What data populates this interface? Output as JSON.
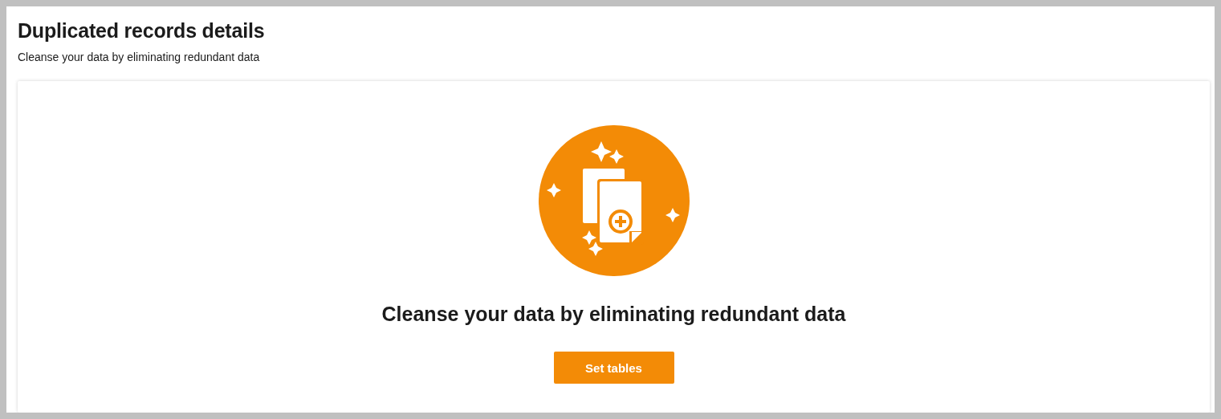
{
  "page": {
    "title": "Duplicated records details",
    "subtitle": "Cleanse your data by eliminating redundant data"
  },
  "empty_state": {
    "heading": "Cleanse your data by eliminating redundant data",
    "button": "Set tables"
  }
}
